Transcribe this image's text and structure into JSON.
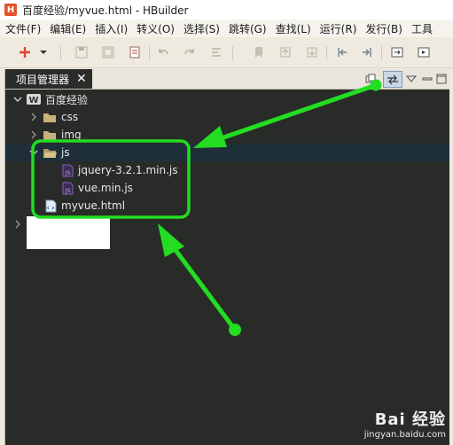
{
  "window": {
    "title": "百度经验/myvue.html  -  HBuilder",
    "logo_letter": "H"
  },
  "menubar": {
    "items": [
      "文件(F)",
      "编辑(E)",
      "插入(I)",
      "转义(O)",
      "选择(S)",
      "跳转(G)",
      "查找(L)",
      "运行(R)",
      "发行(B)",
      "工具"
    ]
  },
  "panel": {
    "tab_label": "项目管理器",
    "tab_close": "✕"
  },
  "tree": {
    "project": {
      "label": "百度经验",
      "icon_letter": "W"
    },
    "folders": [
      {
        "label": "css",
        "expanded": false
      },
      {
        "label": "img",
        "expanded": false
      },
      {
        "label": "js",
        "expanded": true
      }
    ],
    "js_files": [
      {
        "label": "jquery-3.2.1.min.js",
        "icon_letter": "JS"
      },
      {
        "label": "vue.min.js",
        "icon_letter": "JS"
      }
    ],
    "html_file": {
      "label": "myvue.html"
    }
  },
  "watermark": {
    "brand": "Bai 经验",
    "url": "jingyan.baidu.com"
  },
  "colors": {
    "panel_bg": "#292b28",
    "selection": "#1f2f3a",
    "annotation_green": "#22dd22",
    "js_icon": "#8a5cc4",
    "folder_icon": "#c9b27a"
  }
}
